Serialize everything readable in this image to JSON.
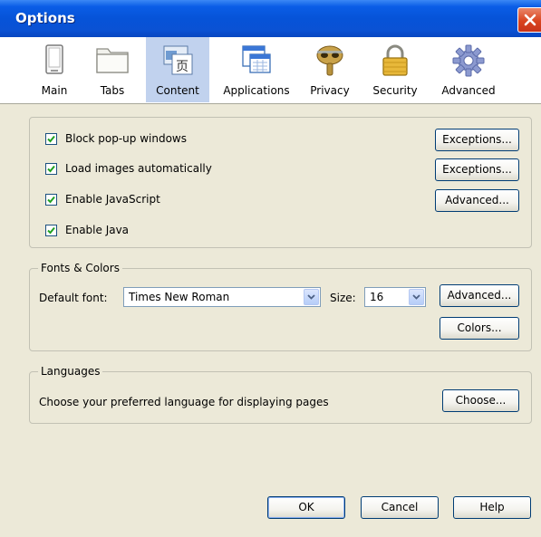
{
  "window": {
    "title": "Options"
  },
  "tabs": [
    {
      "label": "Main",
      "icon": "main-icon",
      "selected": false
    },
    {
      "label": "Tabs",
      "icon": "tabs-folder-icon",
      "selected": false
    },
    {
      "label": "Content",
      "icon": "content-icon",
      "selected": true
    },
    {
      "label": "Applications",
      "icon": "applications-icon",
      "selected": false
    },
    {
      "label": "Privacy",
      "icon": "privacy-mask-icon",
      "selected": false
    },
    {
      "label": "Security",
      "icon": "security-lock-icon",
      "selected": false
    },
    {
      "label": "Advanced",
      "icon": "advanced-gear-icon",
      "selected": false
    }
  ],
  "content": {
    "block_popups": {
      "label": "Block pop-up windows",
      "checked": true,
      "button": "Exceptions..."
    },
    "load_images": {
      "label": "Load images automatically",
      "checked": true,
      "button": "Exceptions..."
    },
    "javascript": {
      "label": "Enable JavaScript",
      "checked": true,
      "button": "Advanced..."
    },
    "java": {
      "label": "Enable Java",
      "checked": true
    }
  },
  "fonts": {
    "legend": "Fonts & Colors",
    "default_font_label": "Default font:",
    "default_font_value": "Times New Roman",
    "size_label": "Size:",
    "size_value": "16",
    "advanced_button": "Advanced...",
    "colors_button": "Colors..."
  },
  "languages": {
    "legend": "Languages",
    "description": "Choose your preferred language for displaying pages",
    "choose_button": "Choose..."
  },
  "footer": {
    "ok": "OK",
    "cancel": "Cancel",
    "help": "Help"
  },
  "colors": {
    "titlebar": "#0653d8",
    "dialog_bg": "#ece9d8",
    "selected_tab": "#c1d2ee",
    "button_border": "#003c74",
    "close_button": "#d9441f"
  }
}
